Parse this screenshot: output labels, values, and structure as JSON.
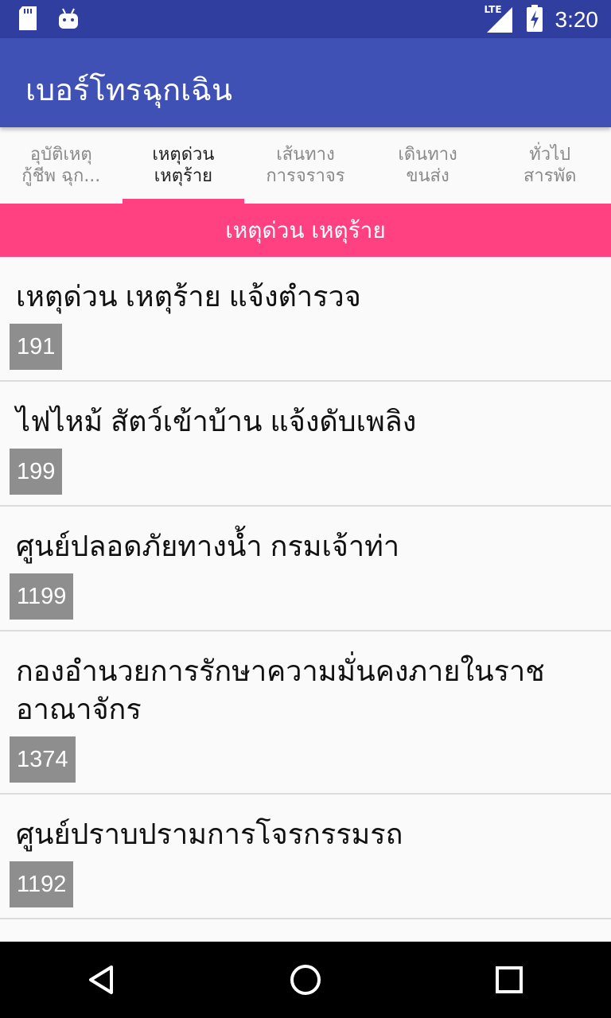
{
  "status_bar": {
    "time": "3:20",
    "network": "LTE",
    "icons": [
      "sd-card-icon",
      "android-icon",
      "signal-icon",
      "battery-charging-icon"
    ]
  },
  "app_bar": {
    "title": "เบอร์โทรฉุกเฉิน"
  },
  "tabs": [
    {
      "line1": "อุบัติเหตุ",
      "line2": "กู้ชีพ ฉุก...",
      "active": false
    },
    {
      "line1": "เหตุด่วน",
      "line2": "เหตุร้าย",
      "active": true
    },
    {
      "line1": "เส้นทาง",
      "line2": "การจราจร",
      "active": false
    },
    {
      "line1": "เดินทาง",
      "line2": "ขนส่ง",
      "active": false
    },
    {
      "line1": "ทั่วไป",
      "line2": "สารพัด",
      "active": false
    }
  ],
  "section_header": "เหตุด่วน เหตุร้าย",
  "items": [
    {
      "title": "เหตุด่วน เหตุร้าย แจ้งตำรวจ",
      "number": "191"
    },
    {
      "title": "ไฟไหม้ สัตว์เข้าบ้าน แจ้งดับเพลิง",
      "number": "199"
    },
    {
      "title": "ศูนย์ปลอดภัยทางน้ำ กรมเจ้าท่า",
      "number": "1199"
    },
    {
      "title": "กองอำนวยการรักษาความมั่นคงภายในราชอาณาจักร",
      "number": "1374"
    },
    {
      "title": "ศูนย์ปราบปรามการโจรกรรมรถ",
      "number": "1192"
    }
  ],
  "colors": {
    "status_bar": "#303f9f",
    "app_bar": "#3f51b5",
    "accent": "#ff4081",
    "badge": "#8e8e8e"
  }
}
